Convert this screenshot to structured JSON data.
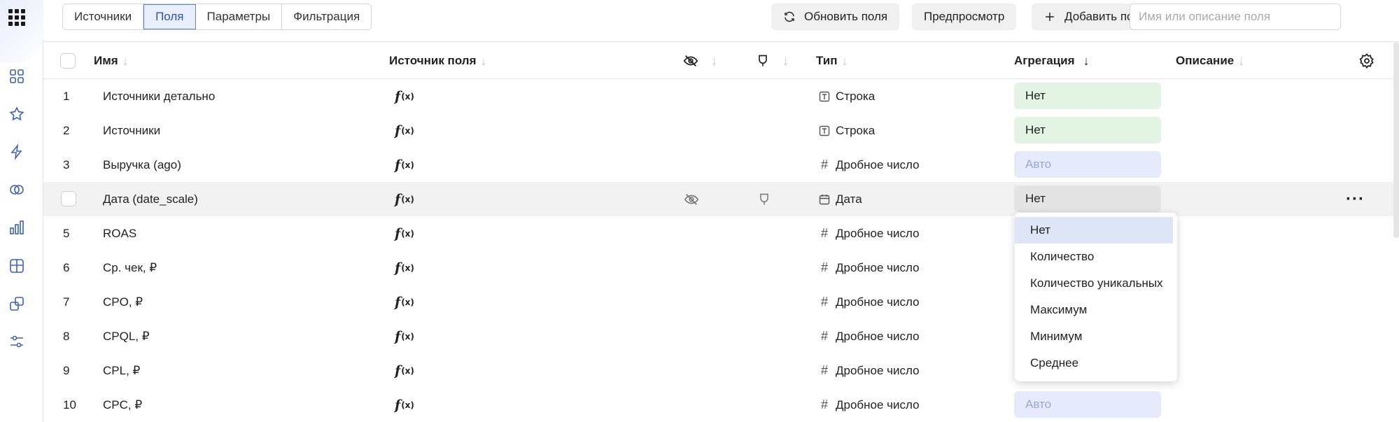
{
  "toolbar": {
    "tabs": [
      "Источники",
      "Поля",
      "Параметры",
      "Фильтрация"
    ],
    "refresh_label": "Обновить поля",
    "preview_label": "Предпросмотр",
    "add_field_label": "Добавить поле",
    "search_placeholder": "Имя или описание поля"
  },
  "table": {
    "columns": {
      "name": "Имя",
      "source": "Источник поля",
      "type": "Тип",
      "aggregation": "Агрегация",
      "description": "Описание"
    },
    "rows": [
      {
        "num": "1",
        "name": "Источники детально",
        "source": "f",
        "source_x": "(x)",
        "type": "Строка",
        "agg": "Нет"
      },
      {
        "num": "2",
        "name": "Источники",
        "source": "f",
        "source_x": "(x)",
        "type": "Строка",
        "agg": "Нет"
      },
      {
        "num": "3",
        "name": "Выручка (ago)",
        "source": "f",
        "source_x": "(x)",
        "type": "Дробное число",
        "agg": "Авто"
      },
      {
        "num": "",
        "name": "Дата (date_scale)",
        "source": "f",
        "source_x": "(x)",
        "type": "Дата",
        "agg": "Нет"
      },
      {
        "num": "5",
        "name": "ROAS",
        "source": "f",
        "source_x": "(x)",
        "type": "Дробное число",
        "agg": ""
      },
      {
        "num": "6",
        "name": "Ср. чек, ₽",
        "source": "f",
        "source_x": "(x)",
        "type": "Дробное число",
        "agg": ""
      },
      {
        "num": "7",
        "name": "CPO, ₽",
        "source": "f",
        "source_x": "(x)",
        "type": "Дробное число",
        "agg": ""
      },
      {
        "num": "8",
        "name": "CPQL, ₽",
        "source": "f",
        "source_x": "(x)",
        "type": "Дробное число",
        "agg": ""
      },
      {
        "num": "9",
        "name": "CPL, ₽",
        "source": "f",
        "source_x": "(x)",
        "type": "Дробное число",
        "agg": ""
      },
      {
        "num": "10",
        "name": "CPC, ₽",
        "source": "f",
        "source_x": "(x)",
        "type": "Дробное число",
        "agg": "Авто"
      }
    ]
  },
  "dropdown": {
    "options": [
      "Нет",
      "Количество",
      "Количество уникальных",
      "Максимум",
      "Минимум",
      "Среднее"
    ]
  },
  "row_menu": "···",
  "colors": {
    "accent": "#5b84d8",
    "agg_none_bg": "#e3f4e4",
    "agg_auto_bg": "#e6ebfc"
  }
}
